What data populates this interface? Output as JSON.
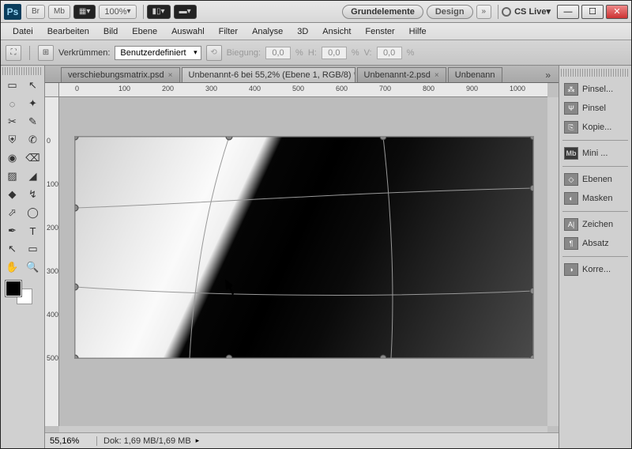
{
  "app": {
    "logo": "Ps"
  },
  "titlebar": {
    "btns": [
      "Br",
      "Mb"
    ],
    "zoom": "100%",
    "grundelemente": "Grundelemente",
    "design": "Design",
    "cs_live": "CS Live"
  },
  "menu": [
    "Datei",
    "Bearbeiten",
    "Bild",
    "Ebene",
    "Auswahl",
    "Filter",
    "Analyse",
    "3D",
    "Ansicht",
    "Fenster",
    "Hilfe"
  ],
  "options": {
    "verkruemmen": "Verkrümmen:",
    "preset": "Benutzerdefiniert",
    "biegung": "Biegung:",
    "biegung_val": "0,0",
    "h_label": "H:",
    "h_val": "0,0",
    "v_label": "V:",
    "v_val": "0,0",
    "pct": "%"
  },
  "tabs": [
    {
      "label": "verschiebungsmatrix.psd",
      "active": false
    },
    {
      "label": "Unbenannt-6 bei 55,2% (Ebene 1, RGB/8) *",
      "active": true
    },
    {
      "label": "Unbenannt-2.psd",
      "active": false
    },
    {
      "label": "Unbenann",
      "active": false
    }
  ],
  "ruler_h": [
    "0",
    "100",
    "200",
    "300",
    "400",
    "500",
    "600",
    "700",
    "800",
    "900",
    "1000"
  ],
  "ruler_v": [
    "0",
    "100",
    "200",
    "300",
    "400",
    "500"
  ],
  "status": {
    "zoom": "55,16%",
    "doc": "Dok: 1,69 MB/1,69 MB"
  },
  "panels": [
    {
      "icon": "⁂",
      "label": "Pinsel..."
    },
    {
      "icon": "Ψ",
      "label": "Pinsel"
    },
    {
      "icon": "⎘",
      "label": "Kopie..."
    },
    {
      "sep": true
    },
    {
      "icon": "Mb",
      "label": "Mini ...",
      "mb": true
    },
    {
      "sep": true
    },
    {
      "icon": "◇",
      "label": "Ebenen"
    },
    {
      "icon": "◐",
      "label": "Masken"
    },
    {
      "sep": true
    },
    {
      "icon": "A|",
      "label": "Zeichen"
    },
    {
      "icon": "¶",
      "label": "Absatz"
    },
    {
      "sep": true
    },
    {
      "icon": "◑",
      "label": "Korre..."
    }
  ],
  "tools": [
    "▭",
    "↖",
    "◌",
    "✦",
    "✂",
    "✎",
    "⛨",
    "✆",
    "◉",
    "⌫",
    "▨",
    "◢",
    "◆",
    "↯",
    "⬀",
    "◯",
    "✒",
    "T",
    "↖",
    "▭",
    "✋",
    "🔍"
  ]
}
